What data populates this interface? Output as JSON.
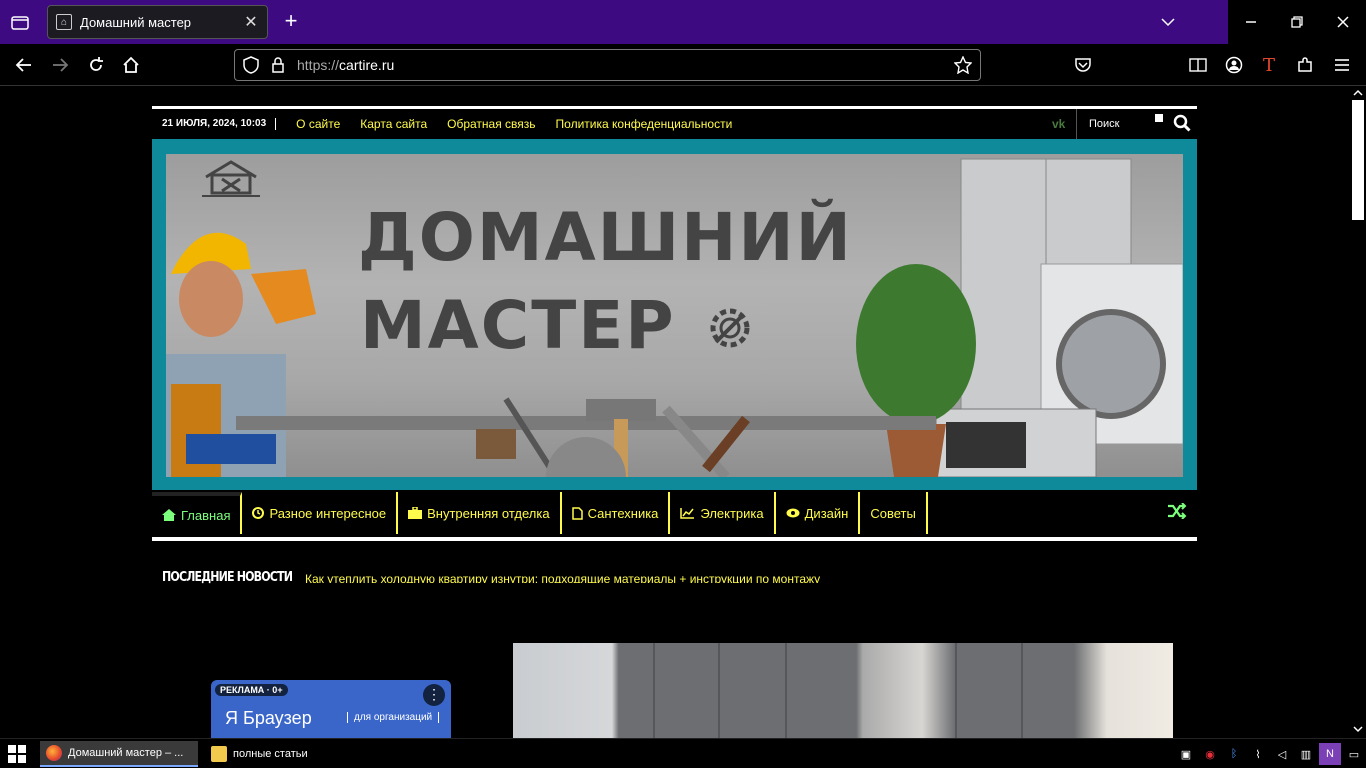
{
  "browser": {
    "tab": {
      "title": "Домашний мастер"
    },
    "url": {
      "scheme": "https://",
      "host": "cartire.ru"
    }
  },
  "topbar": {
    "date": "21 ИЮЛЯ, 2024, 10:03",
    "links": [
      "О сайте",
      "Карта сайта",
      "Обратная связь",
      "Политика конфеденциальности"
    ],
    "search_placeholder": "Поиск"
  },
  "banner": {
    "line1": "ДОМАШНИЙ",
    "line2": "МАСТЕР"
  },
  "mainnav": {
    "items": [
      {
        "label": "Главная",
        "icon": "home-icon"
      },
      {
        "label": "Разное интересное",
        "icon": "clock-icon"
      },
      {
        "label": "Внутренняя отделка",
        "icon": "briefcase-icon"
      },
      {
        "label": "Сантехника",
        "icon": "document-icon"
      },
      {
        "label": "Электрика",
        "icon": "chart-icon"
      },
      {
        "label": "Дизайн",
        "icon": "eye-icon"
      },
      {
        "label": "Советы",
        "icon": ""
      }
    ]
  },
  "news": {
    "label": "ПОСЛЕДНИЕ НОВОСТИ",
    "headline": "Как утеплить холодную квартиру изнутри: подходящие материалы + инструкции по монтажу"
  },
  "ad": {
    "tag": "РЕКЛАМА · 0+",
    "brand": "Я Браузер",
    "org": "для организаций"
  },
  "taskbar": {
    "apps": [
      {
        "label": "Домашний мастер – ..."
      },
      {
        "label": "полные статьи"
      }
    ]
  },
  "colors": {
    "accent_yellow": "#fffb4d",
    "accent_green": "#7cff7c",
    "banner_frame": "#0e8a9a",
    "tabbar": "#3d0a82"
  }
}
